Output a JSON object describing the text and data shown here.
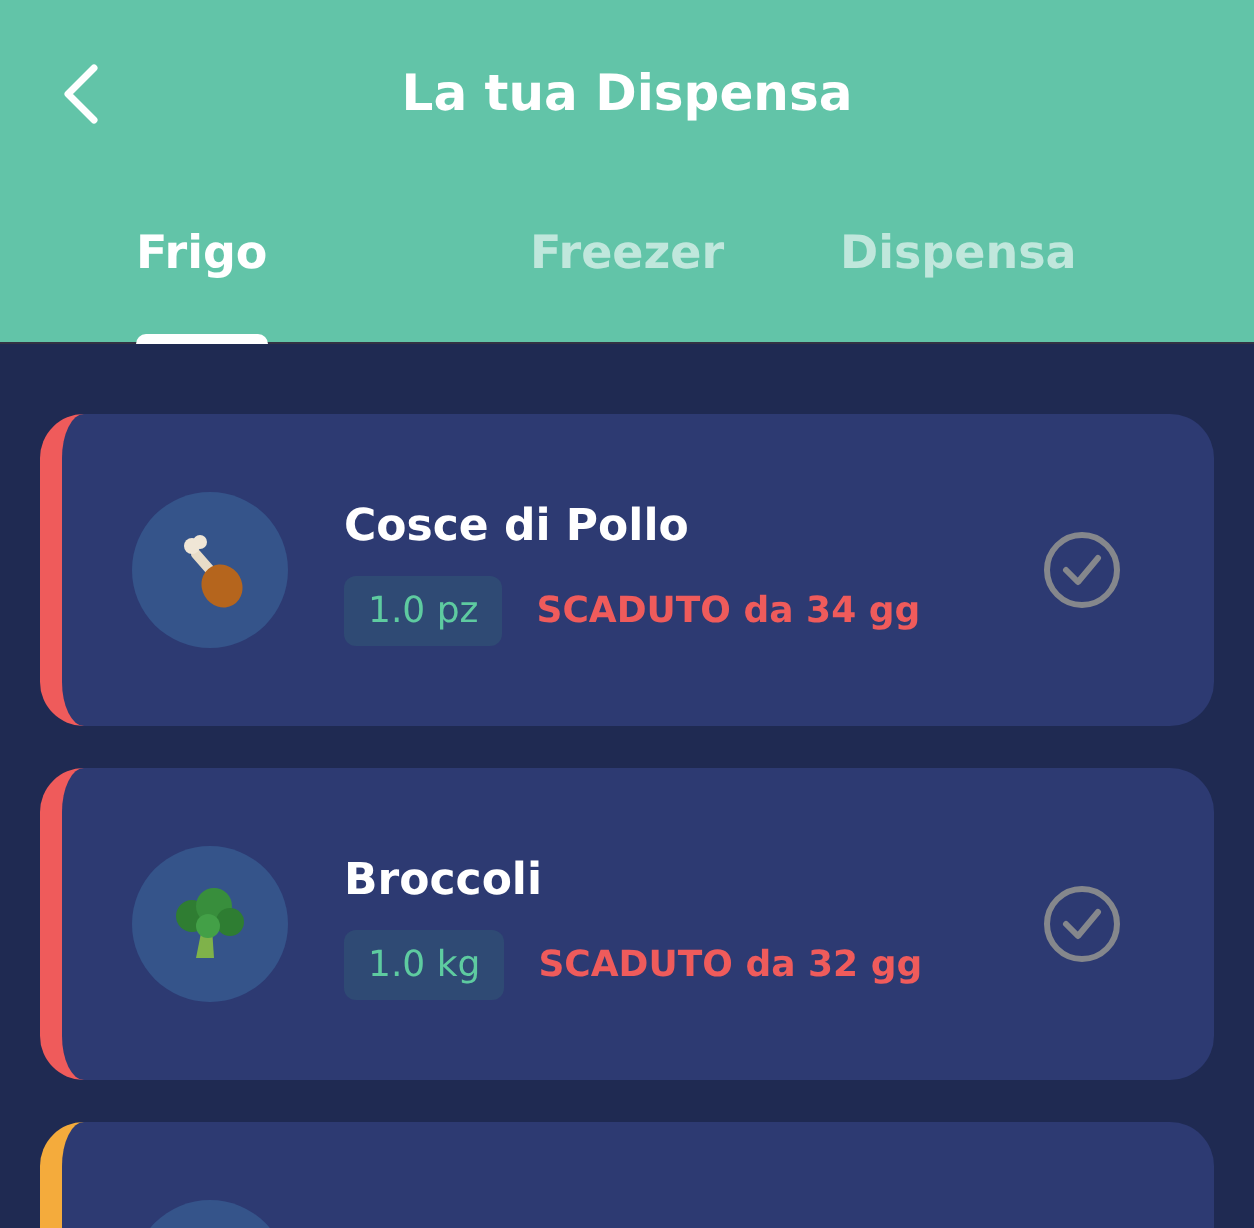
{
  "header": {
    "title": "La tua Dispensa"
  },
  "tabs": [
    {
      "label": "Frigo",
      "selected": true
    },
    {
      "label": "Freezer",
      "selected": false
    },
    {
      "label": "Dispensa",
      "selected": false
    }
  ],
  "items": [
    {
      "name": "Cosce di Pollo",
      "quantity": "1.0 pz",
      "status": "SCADUTO da 34 gg",
      "color": "#ef5b5b"
    },
    {
      "name": "Broccoli",
      "quantity": "1.0 kg",
      "status": "SCADUTO da 32 gg",
      "color": "#ef5b5b"
    },
    {
      "color": "#f4ab3c"
    }
  ]
}
